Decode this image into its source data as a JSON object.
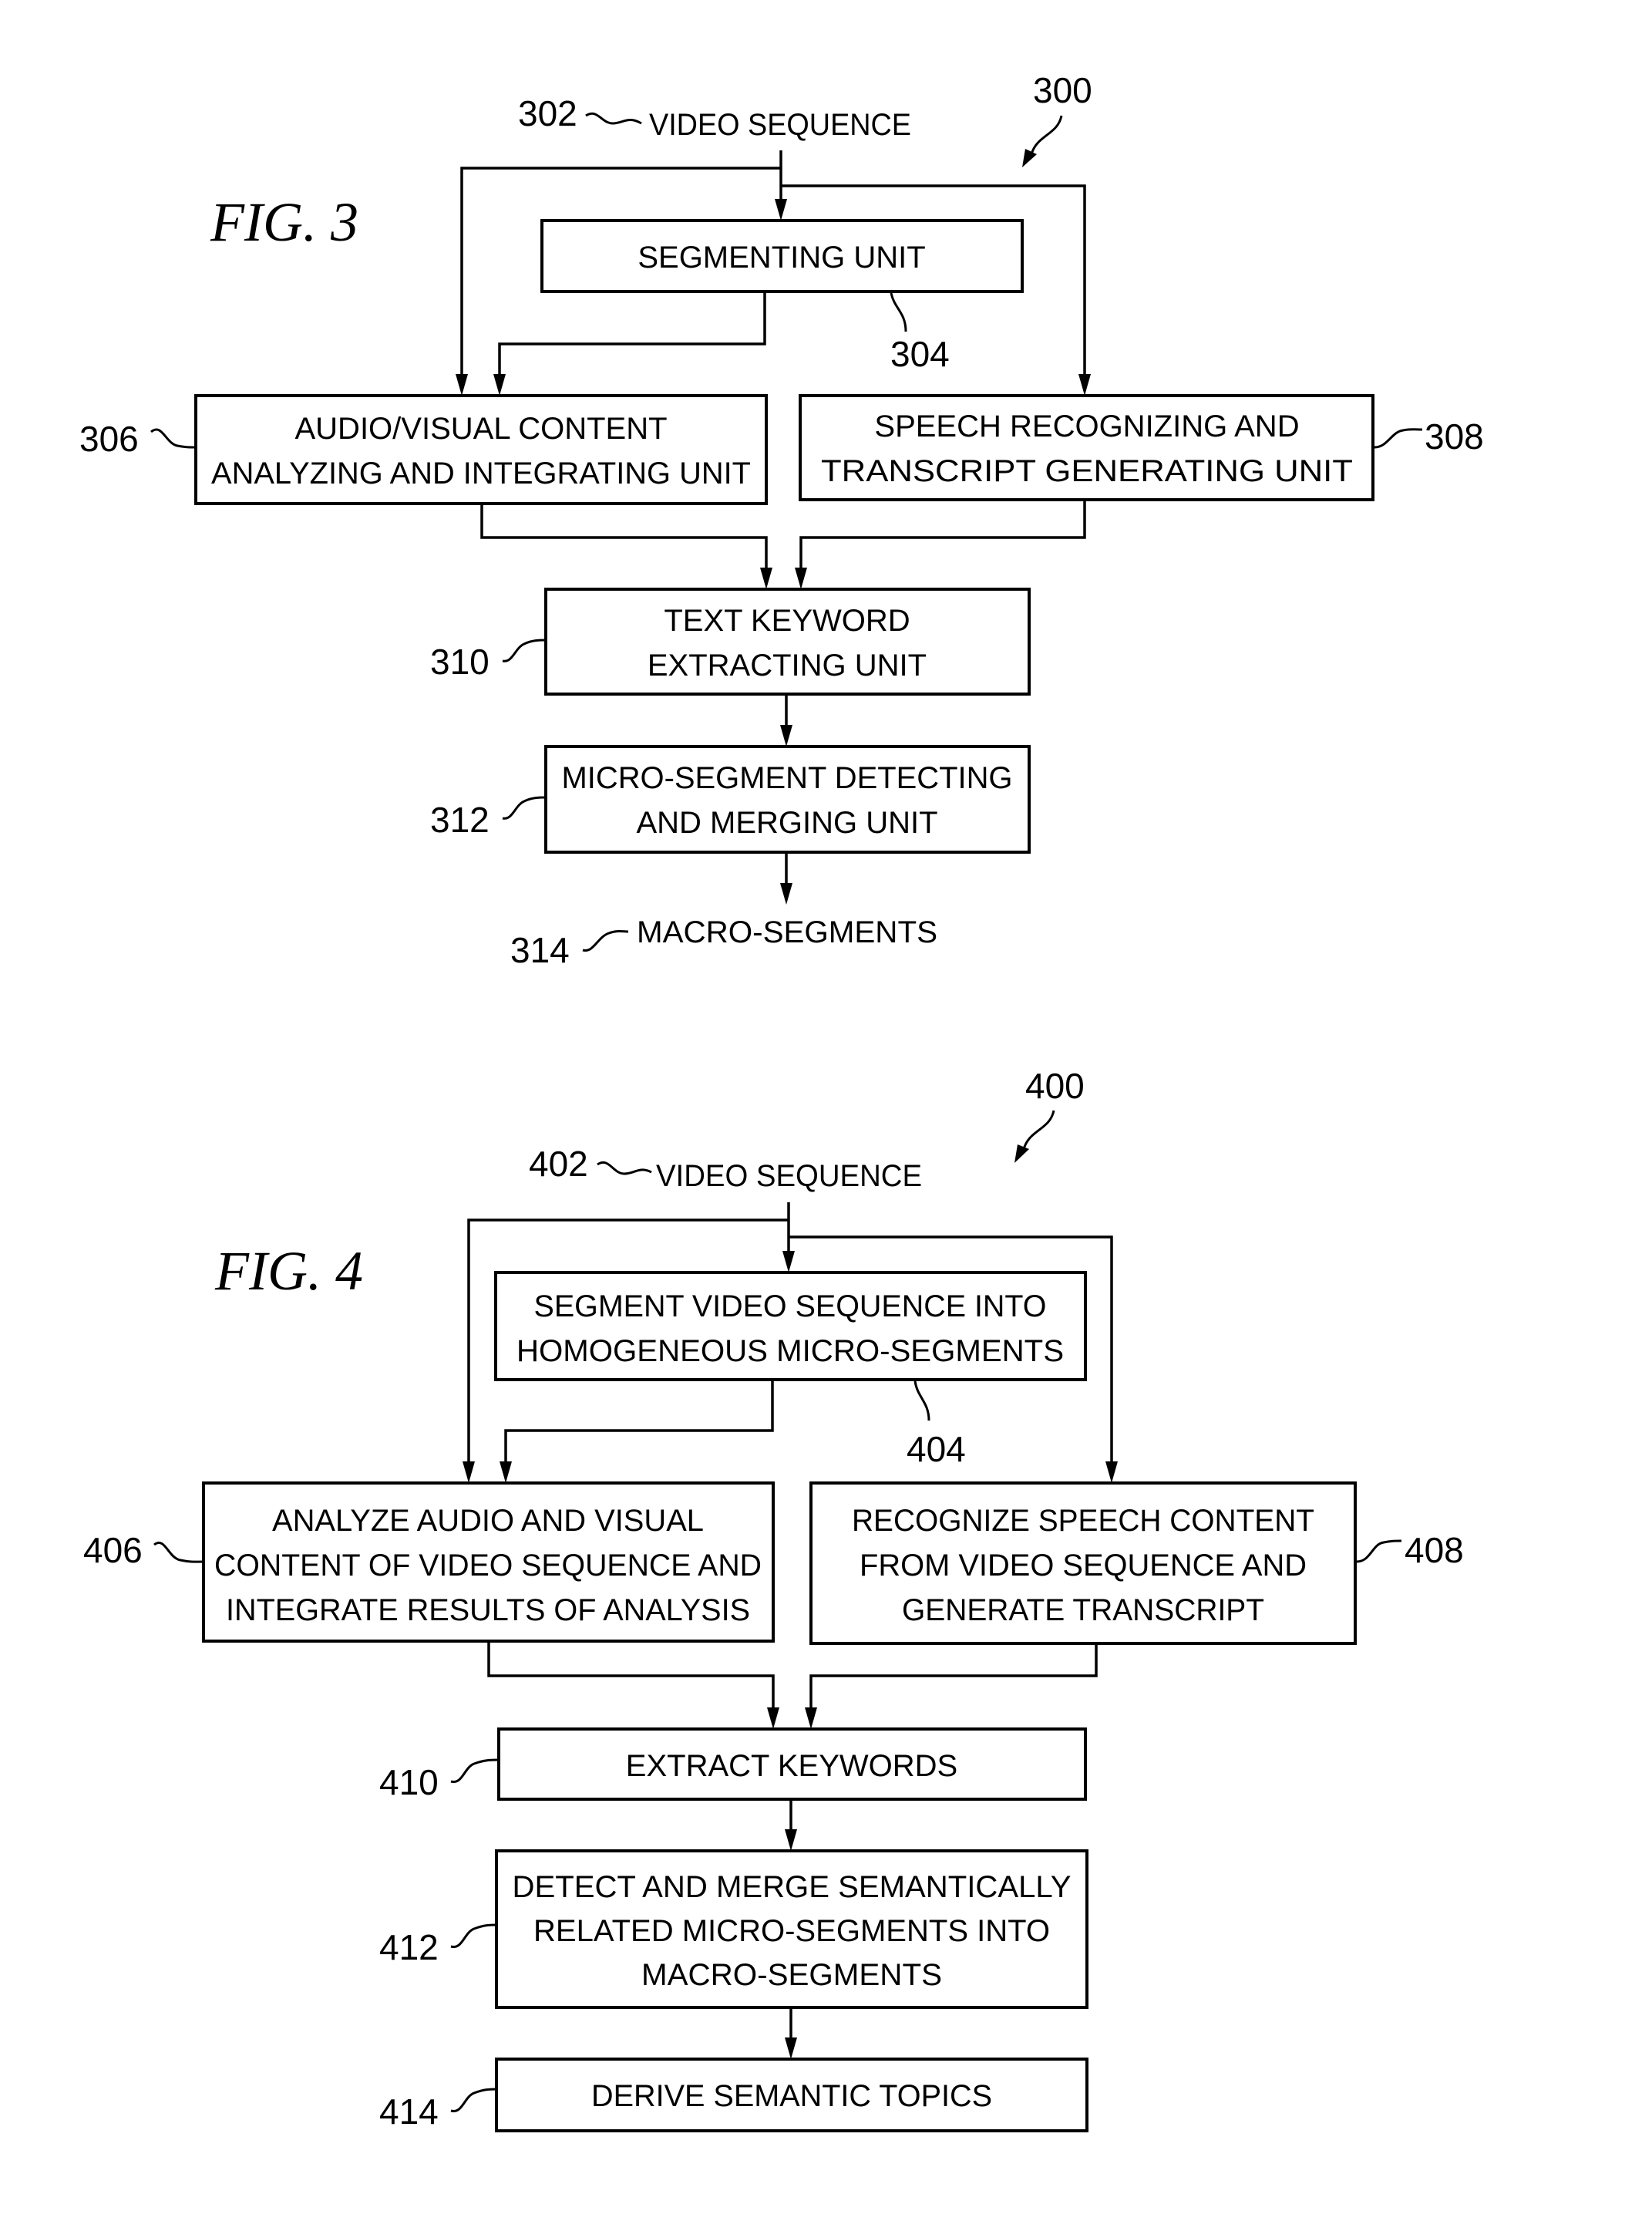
{
  "figures": [
    {
      "title": "FIG. 3",
      "ref": "300",
      "input": {
        "ref": "302",
        "label": "VIDEO SEQUENCE"
      },
      "nodes": [
        {
          "id": "304",
          "ref": "304",
          "lines": [
            "SEGMENTING UNIT"
          ]
        },
        {
          "id": "306",
          "ref": "306",
          "lines": [
            "AUDIO/VISUAL CONTENT",
            "ANALYZING AND INTEGRATING UNIT"
          ]
        },
        {
          "id": "308",
          "ref": "308",
          "lines": [
            "SPEECH RECOGNIZING AND",
            "TRANSCRIPT GENERATING UNIT"
          ]
        },
        {
          "id": "310",
          "ref": "310",
          "lines": [
            "TEXT KEYWORD",
            "EXTRACTING UNIT"
          ]
        },
        {
          "id": "312",
          "ref": "312",
          "lines": [
            "MICRO-SEGMENT DETECTING",
            "AND MERGING UNIT"
          ]
        }
      ],
      "output": {
        "ref": "314",
        "label": "MACRO-SEGMENTS"
      },
      "edges": [
        [
          "302",
          "304"
        ],
        [
          "302",
          "306"
        ],
        [
          "302",
          "308"
        ],
        [
          "304",
          "306"
        ],
        [
          "306",
          "310"
        ],
        [
          "308",
          "310"
        ],
        [
          "310",
          "312"
        ],
        [
          "312",
          "314"
        ]
      ]
    },
    {
      "title": "FIG. 4",
      "ref": "400",
      "input": {
        "ref": "402",
        "label": "VIDEO SEQUENCE"
      },
      "nodes": [
        {
          "id": "404",
          "ref": "404",
          "lines": [
            "SEGMENT VIDEO SEQUENCE INTO",
            "HOMOGENEOUS MICRO-SEGMENTS"
          ]
        },
        {
          "id": "406",
          "ref": "406",
          "lines": [
            "ANALYZE AUDIO AND VISUAL",
            "CONTENT OF VIDEO SEQUENCE AND",
            "INTEGRATE RESULTS OF ANALYSIS"
          ]
        },
        {
          "id": "408",
          "ref": "408",
          "lines": [
            "RECOGNIZE SPEECH CONTENT",
            "FROM VIDEO SEQUENCE AND",
            "GENERATE TRANSCRIPT"
          ]
        },
        {
          "id": "410",
          "ref": "410",
          "lines": [
            "EXTRACT KEYWORDS"
          ]
        },
        {
          "id": "412",
          "ref": "412",
          "lines": [
            "DETECT AND MERGE SEMANTICALLY",
            "RELATED MICRO-SEGMENTS INTO",
            "MACRO-SEGMENTS"
          ]
        },
        {
          "id": "414",
          "ref": "414",
          "lines": [
            "DERIVE SEMANTIC TOPICS"
          ]
        }
      ],
      "edges": [
        [
          "402",
          "404"
        ],
        [
          "402",
          "406"
        ],
        [
          "402",
          "408"
        ],
        [
          "404",
          "406"
        ],
        [
          "406",
          "410"
        ],
        [
          "408",
          "410"
        ],
        [
          "410",
          "412"
        ],
        [
          "412",
          "414"
        ]
      ]
    }
  ]
}
